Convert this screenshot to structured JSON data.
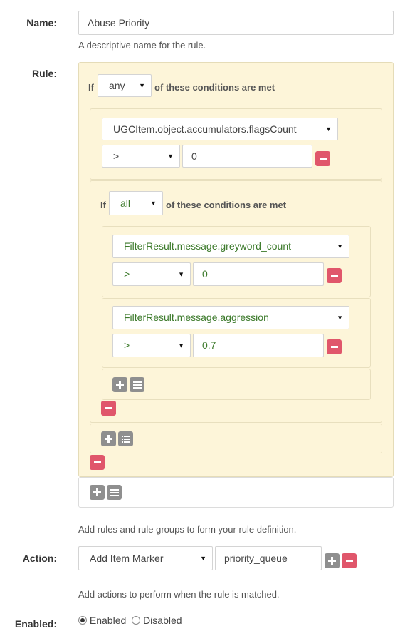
{
  "name": {
    "label": "Name:",
    "value": "Abuse Priority",
    "help": "A descriptive name for the rule."
  },
  "rule": {
    "label": "Rule:",
    "if_text": "If",
    "operator": "any",
    "suffix": "of these conditions are met",
    "conditions": [
      {
        "field": "UGCItem.object.accumulators.flagsCount",
        "comparator": ">",
        "value": "0"
      }
    ],
    "group": {
      "if_text": "If",
      "operator": "all",
      "suffix": "of these conditions are met",
      "conditions": [
        {
          "field": "FilterResult.message.greyword_count",
          "comparator": ">",
          "value": "0"
        },
        {
          "field": "FilterResult.message.aggression",
          "comparator": ">",
          "value": "0.7"
        }
      ]
    },
    "help": "Add rules and rule groups to form your rule definition."
  },
  "action": {
    "label": "Action:",
    "type": "Add Item Marker",
    "value": "priority_queue",
    "help": "Add actions to perform when the rule is matched."
  },
  "enabled": {
    "label": "Enabled:",
    "options": [
      "Enabled",
      "Disabled"
    ],
    "selected": "Enabled"
  },
  "colors": {
    "panel_bg": "#fdf5d9",
    "remove_btn": "#e0566b",
    "add_btn": "#8f8f8f",
    "field_green": "#3c7a2b"
  },
  "icons": {
    "remove": "minus-icon",
    "add_rule": "plus-icon",
    "add_group": "list-icon",
    "caret": "caret-down-icon"
  }
}
